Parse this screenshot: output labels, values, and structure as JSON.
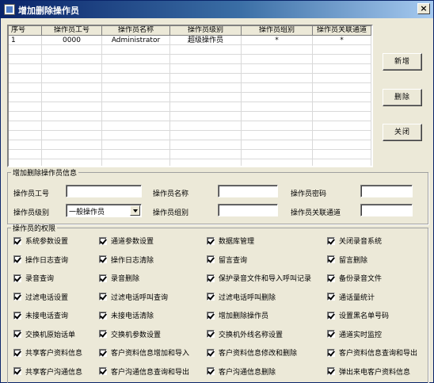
{
  "window": {
    "title": "增加删除操作员",
    "close_glyph": "×"
  },
  "grid": {
    "columns": [
      "序号",
      "操作员工号",
      "操作员名称",
      "操作员级别",
      "操作员组别",
      "操作员关联通道"
    ],
    "rows": [
      [
        "1",
        "0000",
        "Administrator",
        "超级操作员",
        "*",
        "*"
      ]
    ]
  },
  "buttons": {
    "add": "新增",
    "delete": "删除",
    "close": "关闭"
  },
  "info": {
    "legend": "增加删除操作员信息",
    "id_label": "操作员工号",
    "id_value": "",
    "name_label": "操作员名称",
    "name_value": "",
    "pwd_label": "操作员密码",
    "pwd_value": "",
    "level_label": "操作员级别",
    "level_value": "一般操作员",
    "group_label": "操作员组别",
    "group_value": "",
    "channel_label": "操作员关联通道",
    "channel_value": ""
  },
  "permissions": {
    "legend": "操作员的权限",
    "items": [
      [
        "系统参数设置",
        "通道参数设置",
        "数据库管理",
        "关闭录音系统"
      ],
      [
        "操作日志查询",
        "操作日志清除",
        "留言查询",
        "留言删除"
      ],
      [
        "录音查询",
        "录音删除",
        "保护录音文件和导入呼叫记录",
        "备份录音文件"
      ],
      [
        "过滤电话设置",
        "过滤电话呼叫查询",
        "过滤电话呼叫删除",
        "通话量统计"
      ],
      [
        "未接电话查询",
        "未接电话清除",
        "增加删除操作员",
        "设置黑名单号码"
      ],
      [
        "交换机原始话单",
        "交换机参数设置",
        "交换机外线名称设置",
        "通道实时监控"
      ],
      [
        "共享客户资料信息",
        "客户资料信息增加和导入",
        "客户资料信息修改和删除",
        "客户资料信息查询和导出"
      ],
      [
        "共享客户沟通信息",
        "客户沟通信息查询和导出",
        "客户沟通信息删除",
        "弹出来电客户资料信息"
      ]
    ],
    "checked": true
  }
}
